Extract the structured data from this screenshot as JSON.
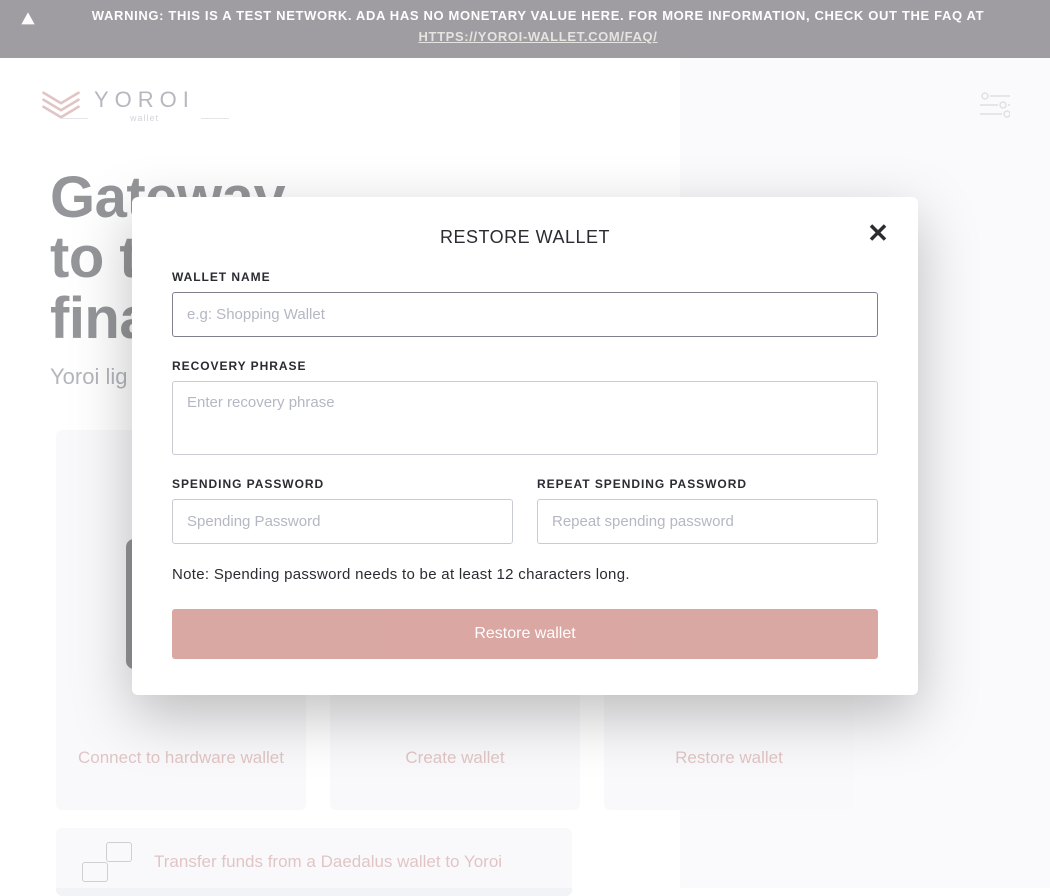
{
  "warning": {
    "text": "WARNING: THIS IS A TEST NETWORK. ADA HAS NO MONETARY VALUE HERE. FOR MORE INFORMATION, CHECK OUT THE FAQ AT ",
    "link_label": "HTTPS://YOROI-WALLET.COM/FAQ/"
  },
  "brand": {
    "name": "YOROI",
    "subtitle": "wallet"
  },
  "hero": {
    "title_line1": "Gateway",
    "title_line2": "to the",
    "title_line3": "fina",
    "subtitle": "Yoroi lig"
  },
  "cards": {
    "hardware": "Connect to hardware wallet",
    "create": "Create wallet",
    "restore": "Restore wallet",
    "transfer": "Transfer funds from a Daedalus wallet to Yoroi"
  },
  "modal": {
    "title": "RESTORE WALLET",
    "wallet_name_label": "WALLET NAME",
    "wallet_name_placeholder": "e.g: Shopping Wallet",
    "recovery_label": "RECOVERY PHRASE",
    "recovery_placeholder": "Enter recovery phrase",
    "spending_pw_label": "SPENDING PASSWORD",
    "spending_pw_placeholder": "Spending Password",
    "repeat_pw_label": "REPEAT SPENDING PASSWORD",
    "repeat_pw_placeholder": "Repeat spending password",
    "note": "Note: Spending password needs to be at least 12 characters long.",
    "submit_label": "Restore wallet"
  },
  "colors": {
    "accent": "#d69e99",
    "warn_bg": "#3e3b45"
  }
}
